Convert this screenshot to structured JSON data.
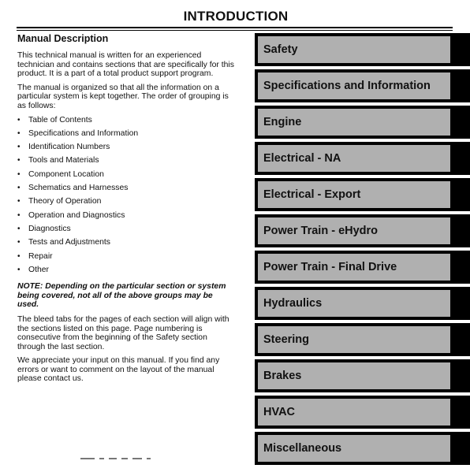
{
  "page": {
    "title": "INTRODUCTION"
  },
  "manual_description": {
    "heading": "Manual Description",
    "para1": "This technical manual is written for an experienced technician and contains sections that are specifically for this product. It is a part of a total product support program.",
    "para2": "The manual is organized so that all the information on a particular system is kept together. The order of grouping is as follows:",
    "groups": [
      "Table of Contents",
      "Specifications and Information",
      "Identification Numbers",
      "Tools and Materials",
      "Component Location",
      "Schematics and Harnesses",
      "Theory of Operation",
      "Operation and Diagnostics",
      "Diagnostics",
      "Tests and Adjustments",
      "Repair",
      "Other"
    ],
    "bullet": "•",
    "note": "NOTE: Depending on the particular section or system being covered, not all of the above groups may be used.",
    "para3": "The bleed tabs for the pages of each section will align with the sections listed on this page. Page numbering is consecutive from the beginning of the Safety section through the last section.",
    "para4": "We appreciate your input on this manual. If you find any errors or want to comment on the layout of the manual please contact us."
  },
  "section_tabs": [
    "Safety",
    "Specifications and Information",
    "Engine",
    "Electrical - NA",
    "Electrical - Export",
    "Power Train - eHydro",
    "Power Train - Final Drive",
    "Hydraulics",
    "Steering",
    "Brakes",
    "HVAC",
    "Miscellaneous"
  ],
  "colors": {
    "tab_frame": "#000000",
    "tab_face": "#b0b0b0",
    "text": "#111111"
  }
}
